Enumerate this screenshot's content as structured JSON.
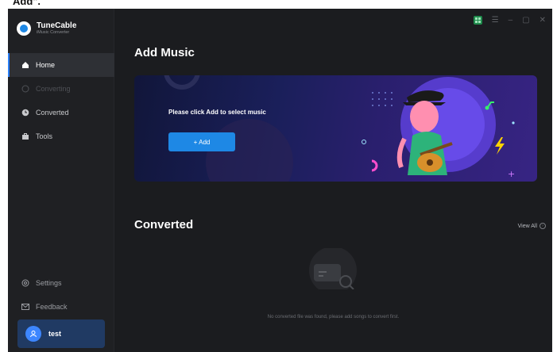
{
  "caption": "Add\".",
  "brand": {
    "name": "TuneCable",
    "subtitle": "iMusic Converter",
    "icon": "tunecable-logo"
  },
  "sidebar": {
    "items": [
      {
        "label": "Home",
        "icon": "home-icon",
        "active": true
      },
      {
        "label": "Converting",
        "icon": "converting-icon",
        "disabled": true
      },
      {
        "label": "Converted",
        "icon": "clock-icon"
      },
      {
        "label": "Tools",
        "icon": "toolbox-icon"
      }
    ],
    "bottom_items": [
      {
        "label": "Settings",
        "icon": "gear-icon"
      },
      {
        "label": "Feedback",
        "icon": "mail-icon"
      }
    ],
    "user": {
      "name": "test",
      "icon": "user-icon"
    }
  },
  "window_controls": {
    "icons": [
      "grid-icon",
      "menu-icon",
      "minimize-icon",
      "maximize-icon",
      "close-icon"
    ]
  },
  "main": {
    "add_title": "Add Music",
    "banner_prompt": "Please click Add to select music",
    "add_button": "+ Add",
    "converted_title": "Converted",
    "view_all": "View All",
    "empty_text": "No converted file was found, please add songs to convert first."
  },
  "colors": {
    "accent": "#1e88e5",
    "sidebar_active": "#2e3035",
    "user_box": "#203a63"
  }
}
